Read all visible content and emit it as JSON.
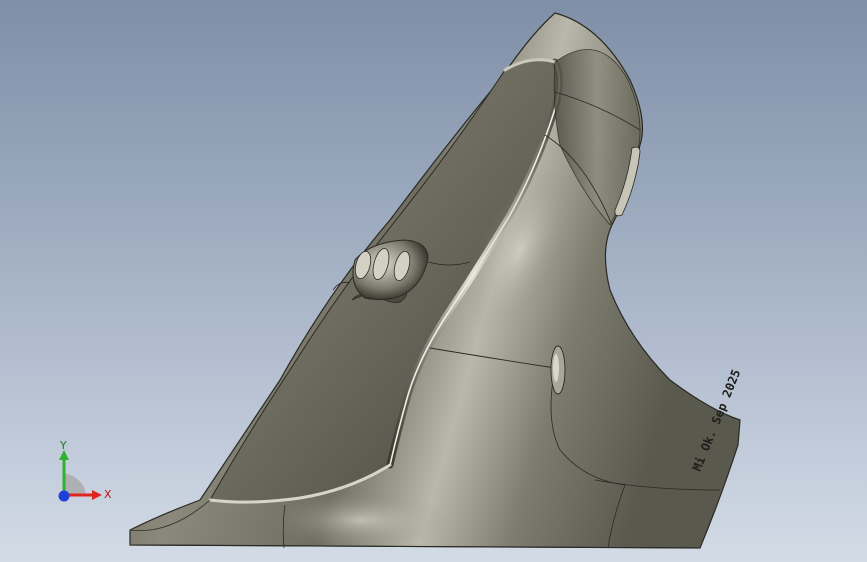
{
  "viewport": {
    "background_top": "#7f8fa6",
    "background_bottom": "#d3dbe6"
  },
  "model": {
    "engraving_text": "Mi Ok. Sep 2025",
    "body_color": "#7b7a6c",
    "highlight_color": "#d9d8cc",
    "shadow_color": "#3e3d33",
    "edge_color": "#2a2a24"
  },
  "triad": {
    "x_label": "X",
    "y_label": "Y",
    "x_color": "#e0241f",
    "y_color": "#2fb12f",
    "z_color": "#1f3fd8"
  }
}
